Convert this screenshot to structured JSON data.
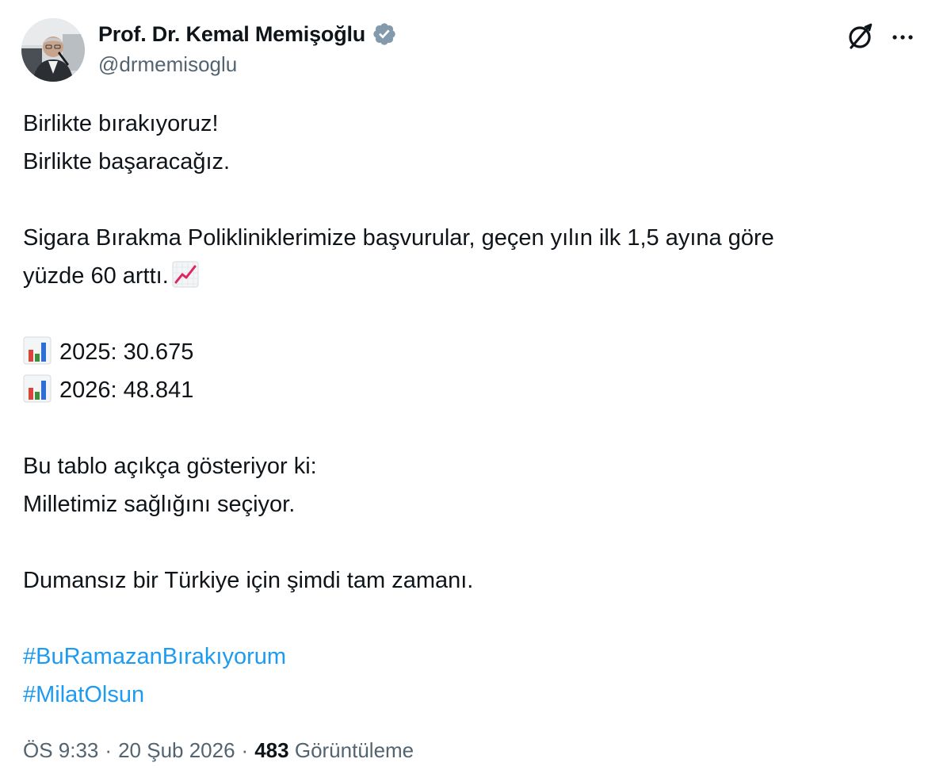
{
  "author": {
    "display_name": "Prof. Dr. Kemal Memişoğlu",
    "handle": "@drmemisoglu",
    "verified": true,
    "verified_color": "#829aab"
  },
  "icons": {
    "avatar": "profile-photo",
    "verified": "verified-badge-icon",
    "grok": "grok-icon",
    "more": "more-options-icon",
    "chart_up": "chart-increasing-emoji",
    "bar_chart": "bar-chart-emoji"
  },
  "tweet": {
    "line1": "Birlikte bırakıyoruz!",
    "line2": "Birlikte başaracağız.",
    "line3": "Sigara Bırakma Polikliniklerimize başvurular, geçen yılın ilk 1,5 ayına göre",
    "line4": "yüzde 60 arttı.",
    "stat_2025": "2025: 30.675",
    "stat_2026": "2026: 48.841",
    "line5": "Bu tablo açıkça gösteriyor ki:",
    "line6": "Milletimiz sağlığını seçiyor.",
    "line7": "Dumansız bir Türkiye için şimdi tam zamanı.",
    "hashtags": [
      "#BuRamazanBırakıyorum",
      "#MilatOlsun"
    ]
  },
  "meta": {
    "time": "ÖS 9:33",
    "separator": "·",
    "date": "20 Şub 2026",
    "views_count": "483",
    "views_label": "Görüntüleme"
  },
  "colors": {
    "text": "#0f1419",
    "secondary": "#536471",
    "link": "#1d9bf0"
  }
}
